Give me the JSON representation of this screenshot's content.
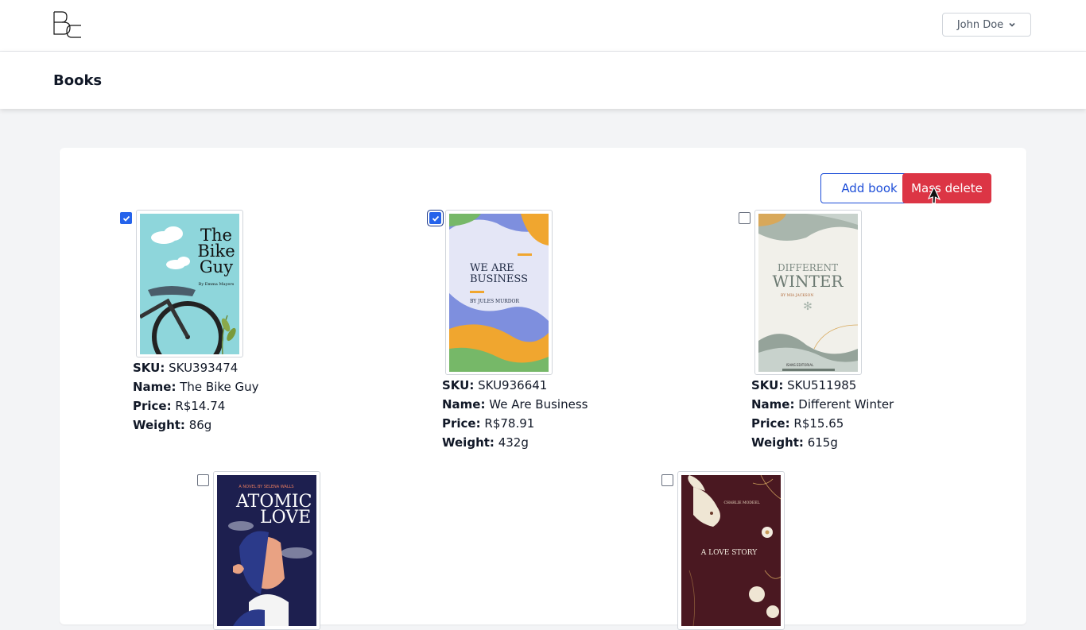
{
  "header": {
    "logo_text": "BC",
    "user_menu_label": "John Doe"
  },
  "page": {
    "title": "Books"
  },
  "toolbar": {
    "add_label": "Add book",
    "mass_delete_label": "Mass delete"
  },
  "labels": {
    "sku": "SKU:",
    "name": "Name:",
    "price": "Price:",
    "weight": "Weight:"
  },
  "books": [
    {
      "checked": true,
      "sku": "SKU393474",
      "name": "The Bike Guy",
      "price": "R$14.74",
      "weight": "86g",
      "cover": {
        "title_lines": [
          "The",
          "Bike",
          "Guy"
        ],
        "author": "By Emma Mayers"
      }
    },
    {
      "checked": true,
      "sku": "SKU936641",
      "name": "We Are Business",
      "price": "R$78.91",
      "weight": "432g",
      "cover": {
        "title_lines": [
          "WE ARE",
          "BUSINESS"
        ],
        "author": "BY JULES MURDOR"
      }
    },
    {
      "checked": false,
      "sku": "SKU511985",
      "name": "Different Winter",
      "price": "R$15.65",
      "weight": "615g",
      "cover": {
        "title_lines": [
          "DIFFERENT",
          "WINTER"
        ],
        "author": "BY MIA JACKSON",
        "publisher": "ISANS EDITORIAL"
      }
    },
    {
      "checked": false,
      "cover": {
        "title_lines": [
          "ATOMIC",
          "LOVE"
        ],
        "author": "A NOVEL BY SELENA WALLS"
      }
    },
    {
      "checked": false,
      "cover": {
        "title_lines": [
          "A LOVE STORY"
        ],
        "author": "CHARLIE MODEEL"
      }
    }
  ],
  "colors": {
    "primary": "#1d4ed8",
    "danger": "#dc3545",
    "checkbox": "#2563eb"
  }
}
